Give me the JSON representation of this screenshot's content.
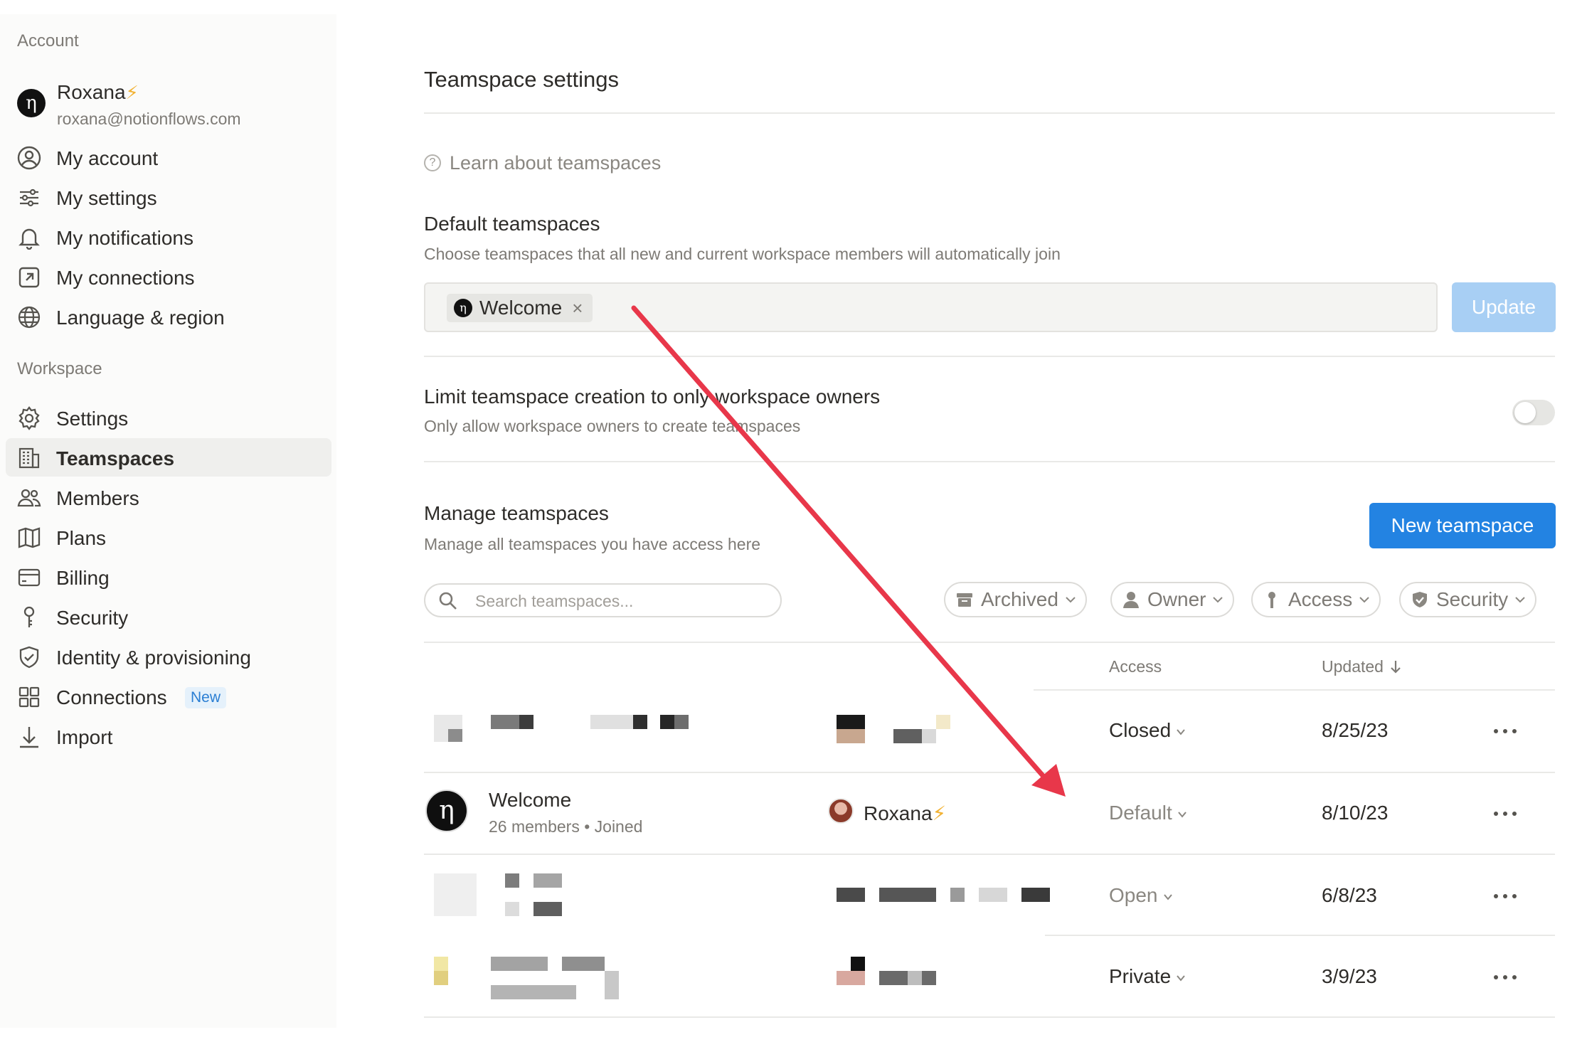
{
  "sidebar": {
    "account_heading": "Account",
    "user": {
      "name": "Roxana",
      "bolt": "⚡",
      "email": "roxana@notionflows.com",
      "avatar_glyph": "η"
    },
    "account_items": [
      {
        "label": "My account",
        "icon": "user-circle-icon"
      },
      {
        "label": "My settings",
        "icon": "sliders-icon"
      },
      {
        "label": "My notifications",
        "icon": "bell-icon"
      },
      {
        "label": "My connections",
        "icon": "external-link-icon"
      },
      {
        "label": "Language & region",
        "icon": "globe-icon"
      }
    ],
    "workspace_heading": "Workspace",
    "workspace_items": [
      {
        "label": "Settings",
        "icon": "gear-icon"
      },
      {
        "label": "Teamspaces",
        "icon": "building-icon",
        "active": true
      },
      {
        "label": "Members",
        "icon": "people-icon"
      },
      {
        "label": "Plans",
        "icon": "map-icon"
      },
      {
        "label": "Billing",
        "icon": "card-icon"
      },
      {
        "label": "Security",
        "icon": "key-icon"
      },
      {
        "label": "Identity & provisioning",
        "icon": "shield-icon"
      },
      {
        "label": "Connections",
        "icon": "grid-icon",
        "badge": "New"
      },
      {
        "label": "Import",
        "icon": "download-icon"
      }
    ]
  },
  "main": {
    "title": "Teamspace settings",
    "learn_link": "Learn about teamspaces",
    "default_teamspaces": {
      "title": "Default teamspaces",
      "description": "Choose teamspaces that all new and current workspace members will automatically join",
      "chip_label": "Welcome",
      "update_label": "Update"
    },
    "limit_creation": {
      "title": "Limit teamspace creation to only workspace owners",
      "description": "Only allow workspace owners to create teamspaces",
      "enabled": false
    },
    "manage": {
      "title": "Manage teamspaces",
      "description": "Manage all teamspaces you have access here",
      "new_button": "New teamspace",
      "search_placeholder": "Search teamspaces...",
      "filters": [
        "Archived",
        "Owner",
        "Access",
        "Security"
      ],
      "columns": {
        "access": "Access",
        "updated": "Updated"
      },
      "rows": [
        {
          "access": "Closed",
          "updated": "8/25/23"
        },
        {
          "name": "Welcome",
          "meta": "26 members • Joined",
          "owner": "Roxana",
          "owner_bolt": "⚡",
          "access": "Default",
          "updated": "8/10/23"
        },
        {
          "access": "Open",
          "updated": "6/8/23"
        },
        {
          "access": "Private",
          "updated": "3/9/23"
        }
      ]
    }
  },
  "colors": {
    "accent": "#2383e2",
    "update_disabled": "#a8cff4",
    "arrow": "#e8374a",
    "sidebar_bg": "#fbfbfa"
  }
}
